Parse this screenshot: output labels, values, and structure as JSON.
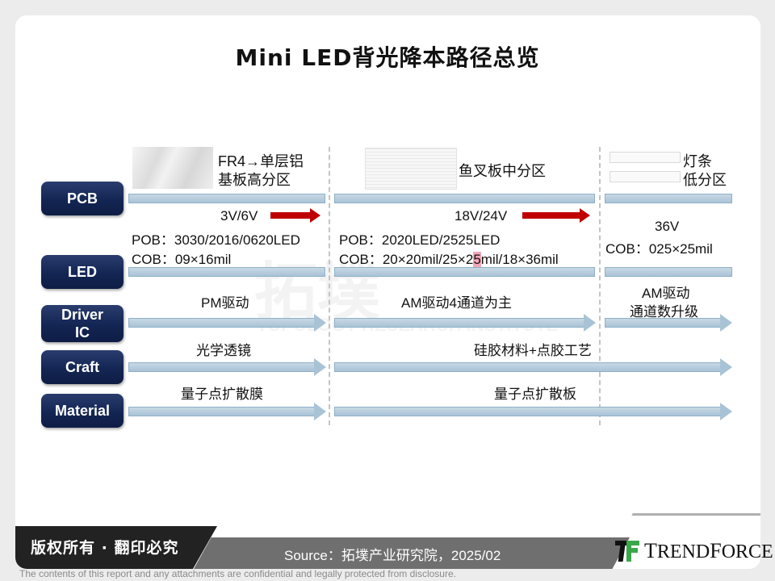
{
  "title": "Mini LED背光降本路径总览",
  "categories": [
    "PCB",
    "LED",
    "Driver IC",
    "Craft",
    "Material"
  ],
  "pcb": {
    "phase1": [
      "FR4→单层铝",
      "基板高分区"
    ],
    "phase2": "鱼叉板中分区",
    "phase3": [
      "灯条",
      "低分区"
    ]
  },
  "led": {
    "phase1": {
      "voltage": "3V/6V",
      "pob": "POB：3030/2016/0620LED",
      "cob": "COB：09×16mil"
    },
    "phase2": {
      "voltage": "18V/24V",
      "pob": "POB：2020LED/2525LED",
      "cob_pre": "COB：20×20mil/25×2",
      "cob_hl": "5",
      "cob_post": "mil/18×36mil"
    },
    "phase3": {
      "voltage": "36V",
      "cob": "COB：025×25mil"
    }
  },
  "driver_ic": {
    "phase1": "PM驱动",
    "phase2": "AM驱动4通道为主",
    "phase3": [
      "AM驱动",
      "通道数升级"
    ]
  },
  "craft": {
    "phase1": "光学透镜",
    "phase2": "硅胶材料+点胶工艺"
  },
  "material": {
    "phase1": "量子点扩散膜",
    "phase2": "量子点扩散板"
  },
  "watermark": {
    "cn": "拓墣",
    "en": "TOPOLOGY RESEARCH INSTITUTE"
  },
  "footer": {
    "copyright": "版权所有 · 翻印必究",
    "source": "Source：拓墣产业研究院，2025/02",
    "logo_text_1": "T",
    "logo_text_2": "REND",
    "logo_text_3": "F",
    "logo_text_4": "ORCE",
    "disclaimer": "The contents of this report and any attachments are confidential and legally protected from disclosure."
  },
  "colors": {
    "accent_red": "#c00000",
    "category_navy": "#132553",
    "bar_blue": "#a9c3d6",
    "logo_green": "#3aa84a"
  }
}
